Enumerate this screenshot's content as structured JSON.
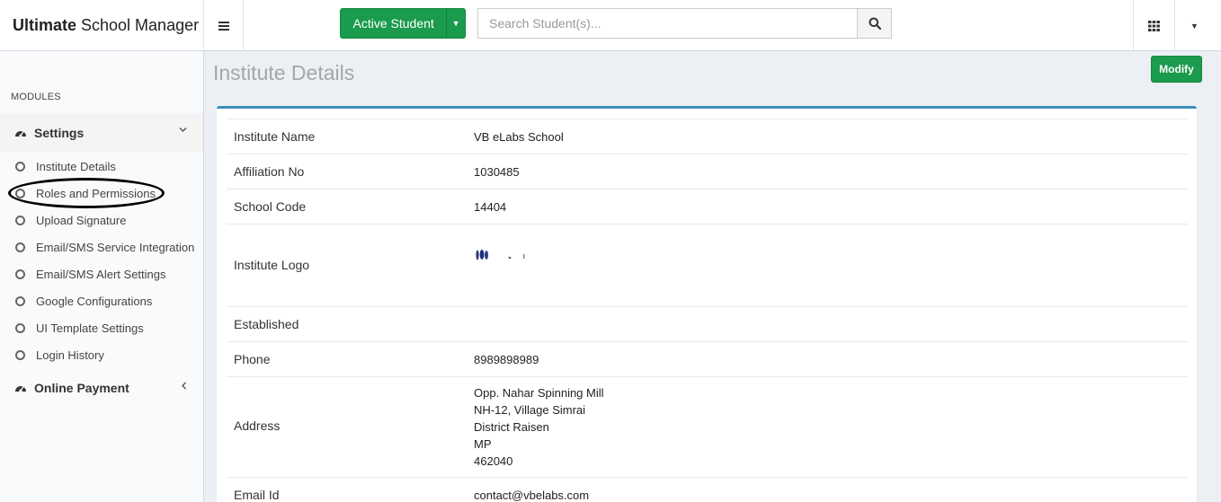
{
  "header": {
    "brand_bold": "Ultimate",
    "brand_rest": "School Manager",
    "student_filter_label": "Active Student",
    "search_placeholder": "Search Student(s)..."
  },
  "sidebar": {
    "section_header": "MODULES",
    "groups": [
      {
        "label": "Settings",
        "expanded": true,
        "items": [
          {
            "label": "Institute Details"
          },
          {
            "label": "Roles and Permissions"
          },
          {
            "label": "Upload Signature"
          },
          {
            "label": "Email/SMS Service Integration"
          },
          {
            "label": "Email/SMS Alert Settings"
          },
          {
            "label": "Google Configurations"
          },
          {
            "label": "UI Template Settings"
          },
          {
            "label": "Login History"
          }
        ]
      },
      {
        "label": "Online Payment",
        "expanded": false
      }
    ]
  },
  "main": {
    "title": "Institute Details",
    "modify_label": "Modify",
    "details": [
      {
        "label": "Institute Name",
        "value": "VB eLabs School"
      },
      {
        "label": "Affiliation No",
        "value": "1030485"
      },
      {
        "label": "School Code",
        "value": "14404"
      },
      {
        "label": "Institute Logo",
        "value": ""
      },
      {
        "label": "Established",
        "value": ""
      },
      {
        "label": "Phone",
        "value": "8989898989"
      },
      {
        "label": "Address",
        "lines": [
          "Opp. Nahar Spinning Mill",
          "NH-12, Village Simrai",
          "District Raisen",
          "MP",
          "462040"
        ]
      },
      {
        "label": "Email Id",
        "value": "contact@vbelabs.com"
      }
    ]
  },
  "colors": {
    "accent_green": "#1a9b4d",
    "box_border_blue": "#3c8dbc",
    "annotation": "#000000"
  },
  "icons": {
    "menu_toggle": "hamburger-icon",
    "search": "search-icon",
    "apps": "grid-icon",
    "user_menu": "caret-down-icon",
    "group": "dashboard-icon",
    "sub_item": "circle-icon"
  }
}
